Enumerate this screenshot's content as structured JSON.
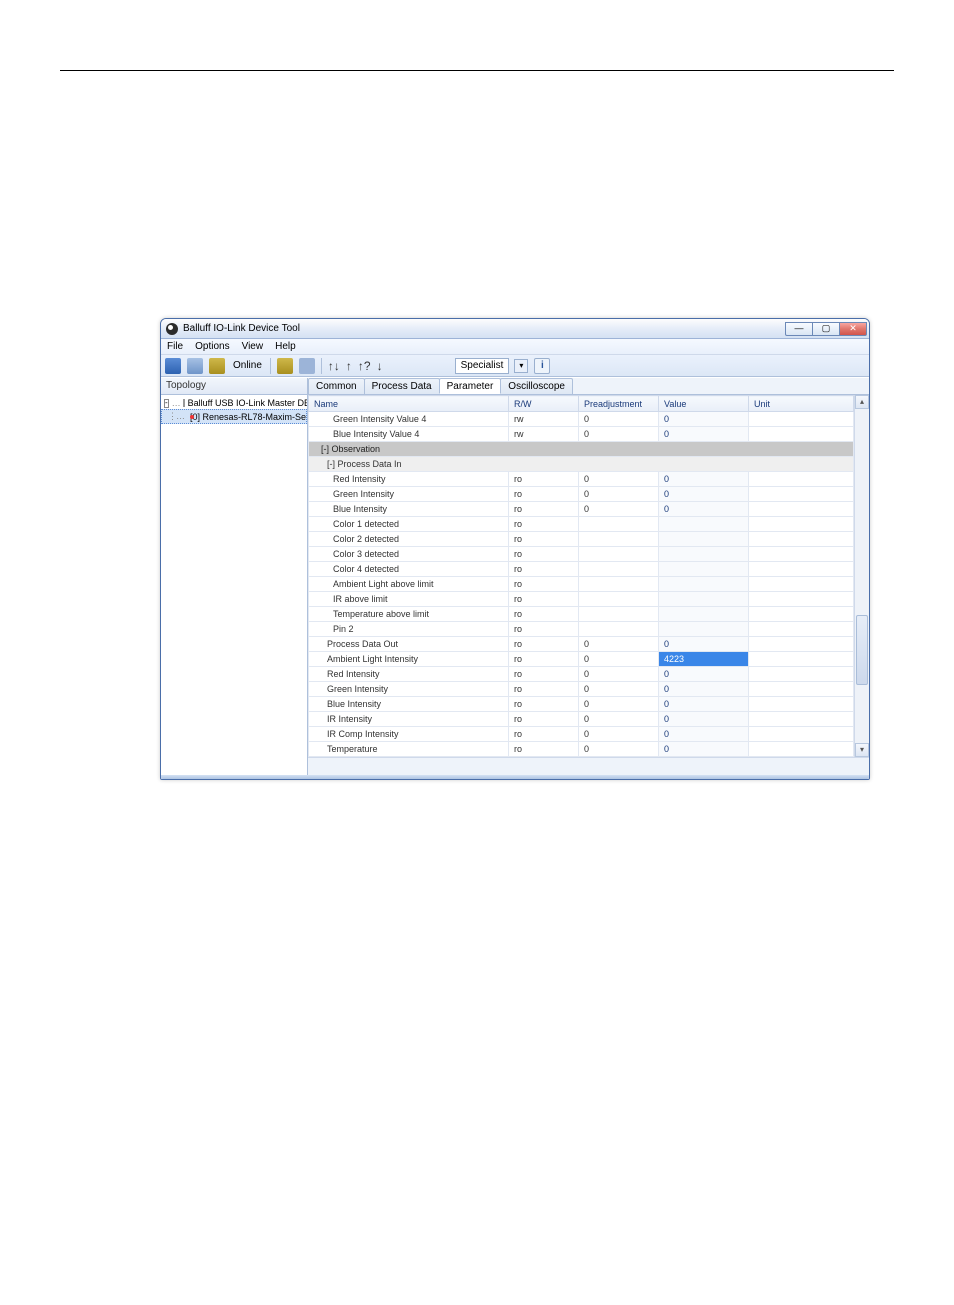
{
  "window": {
    "title": "Balluff IO-Link Device Tool"
  },
  "menu": {
    "items": [
      "File",
      "Options",
      "View",
      "Help"
    ]
  },
  "toolbar": {
    "online_label": "Online",
    "role_label": "Specialist"
  },
  "sidebar": {
    "header": "Topology",
    "tree": {
      "root": "Balluff USB IO-Link Master DE (l",
      "child": "[0] Renesas-RL78-Maxim-Se"
    }
  },
  "tabs": {
    "items": [
      "Common",
      "Process Data",
      "Parameter",
      "Oscilloscope"
    ],
    "active": 2
  },
  "columns": [
    "Name",
    "R/W",
    "Preadjustment",
    "Value",
    "Unit"
  ],
  "rows": [
    {
      "type": "data",
      "indent": 2,
      "name": "Green Intensity Value 4",
      "rw": "rw",
      "pre": "0",
      "val": "0",
      "unit": ""
    },
    {
      "type": "data",
      "indent": 2,
      "name": "Blue Intensity Value 4",
      "rw": "rw",
      "pre": "0",
      "val": "0",
      "unit": ""
    },
    {
      "type": "section",
      "indent": 0,
      "name": "[-] Observation"
    },
    {
      "type": "sub",
      "indent": 1,
      "name": "[-] Process Data In"
    },
    {
      "type": "data",
      "indent": 2,
      "name": "Red Intensity",
      "rw": "ro",
      "pre": "0",
      "val": "0",
      "unit": ""
    },
    {
      "type": "data",
      "indent": 2,
      "name": "Green Intensity",
      "rw": "ro",
      "pre": "0",
      "val": "0",
      "unit": ""
    },
    {
      "type": "data",
      "indent": 2,
      "name": "Blue Intensity",
      "rw": "ro",
      "pre": "0",
      "val": "0",
      "unit": ""
    },
    {
      "type": "data",
      "indent": 2,
      "name": "Color 1 detected",
      "rw": "ro",
      "pre": "",
      "val": "",
      "unit": ""
    },
    {
      "type": "data",
      "indent": 2,
      "name": "Color 2 detected",
      "rw": "ro",
      "pre": "",
      "val": "",
      "unit": ""
    },
    {
      "type": "data",
      "indent": 2,
      "name": "Color 3 detected",
      "rw": "ro",
      "pre": "",
      "val": "",
      "unit": ""
    },
    {
      "type": "data",
      "indent": 2,
      "name": "Color 4 detected",
      "rw": "ro",
      "pre": "",
      "val": "",
      "unit": ""
    },
    {
      "type": "data",
      "indent": 2,
      "name": "Ambient Light above limit",
      "rw": "ro",
      "pre": "",
      "val": "",
      "unit": ""
    },
    {
      "type": "data",
      "indent": 2,
      "name": "IR above limit",
      "rw": "ro",
      "pre": "",
      "val": "",
      "unit": ""
    },
    {
      "type": "data",
      "indent": 2,
      "name": "Temperature above limit",
      "rw": "ro",
      "pre": "",
      "val": "",
      "unit": ""
    },
    {
      "type": "data",
      "indent": 2,
      "name": "Pin 2",
      "rw": "ro",
      "pre": "",
      "val": "",
      "unit": ""
    },
    {
      "type": "data",
      "indent": 1,
      "name": "Process Data Out",
      "rw": "ro",
      "pre": "0",
      "val": "0",
      "unit": ""
    },
    {
      "type": "data",
      "indent": 1,
      "name": "Ambient Light Intensity",
      "rw": "ro",
      "pre": "0",
      "val": "4223",
      "unit": "",
      "hl": true
    },
    {
      "type": "data",
      "indent": 1,
      "name": "Red Intensity",
      "rw": "ro",
      "pre": "0",
      "val": "0",
      "unit": ""
    },
    {
      "type": "data",
      "indent": 1,
      "name": "Green Intensity",
      "rw": "ro",
      "pre": "0",
      "val": "0",
      "unit": ""
    },
    {
      "type": "data",
      "indent": 1,
      "name": "Blue Intensity",
      "rw": "ro",
      "pre": "0",
      "val": "0",
      "unit": ""
    },
    {
      "type": "data",
      "indent": 1,
      "name": "IR Intensity",
      "rw": "ro",
      "pre": "0",
      "val": "0",
      "unit": ""
    },
    {
      "type": "data",
      "indent": 1,
      "name": "IR Comp Intensity",
      "rw": "ro",
      "pre": "0",
      "val": "0",
      "unit": ""
    },
    {
      "type": "data",
      "indent": 1,
      "name": "Temperature",
      "rw": "ro",
      "pre": "0",
      "val": "0",
      "unit": ""
    }
  ]
}
